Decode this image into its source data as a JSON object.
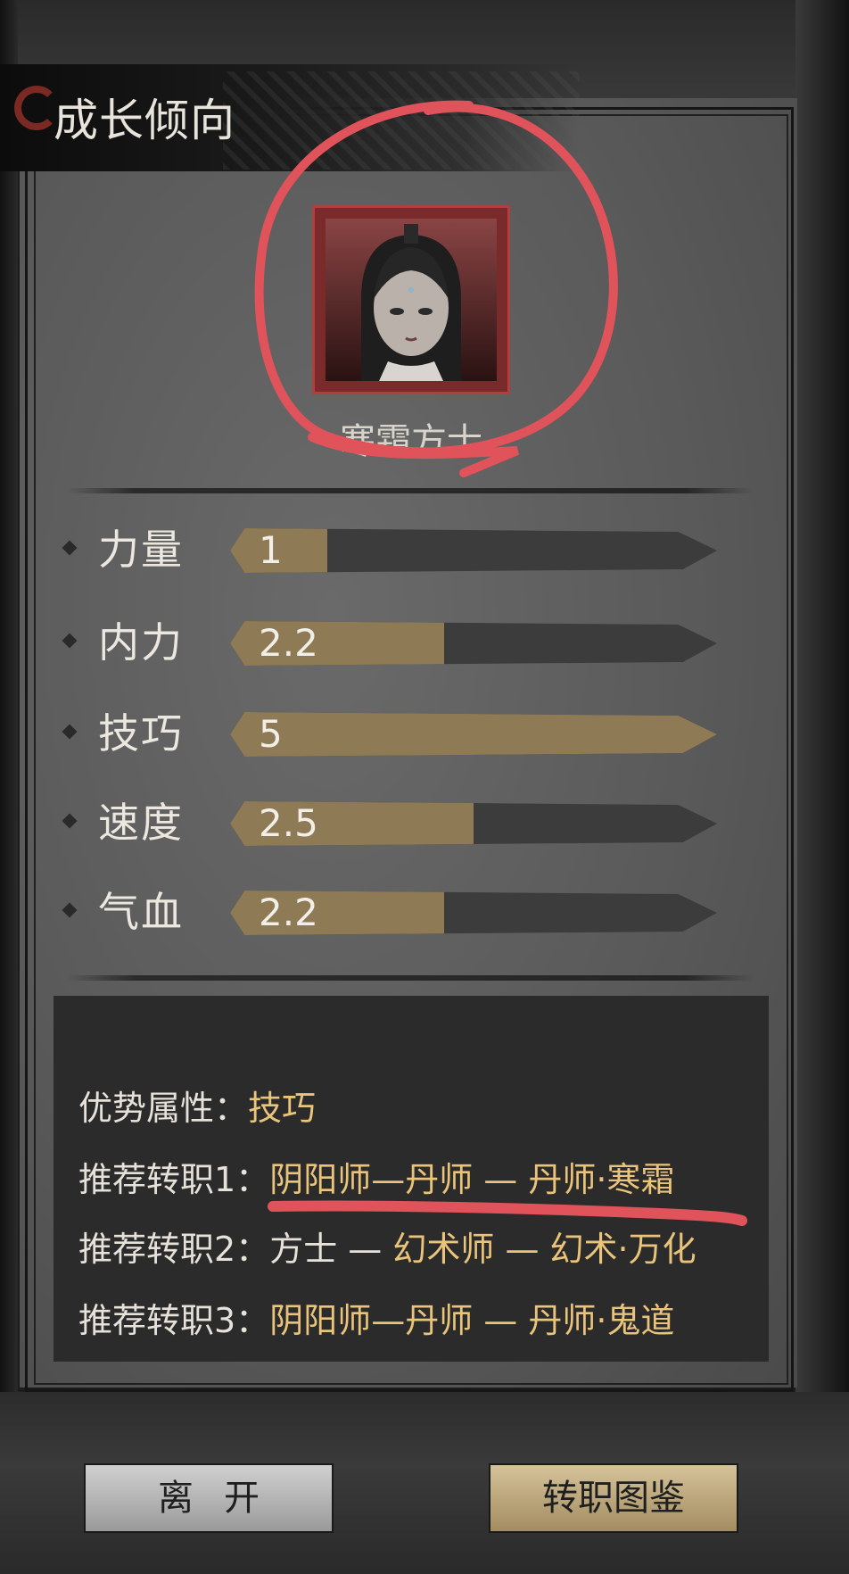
{
  "title": "成长倾向",
  "character": {
    "name": "寒霜方士"
  },
  "stats": [
    {
      "label": "力量",
      "value": "1",
      "fraction": 0.2
    },
    {
      "label": "内力",
      "value": "2.2",
      "fraction": 0.44
    },
    {
      "label": "技巧",
      "value": "5",
      "fraction": 1.0
    },
    {
      "label": "速度",
      "value": "2.5",
      "fraction": 0.5
    },
    {
      "label": "气血",
      "value": "2.2",
      "fraction": 0.44
    }
  ],
  "info": {
    "advantage_label": "优势属性：",
    "advantage_value": "技巧",
    "rec1_label": "推荐转职1：",
    "rec1_value": "阴阳师—丹师 — 丹师·寒霜",
    "rec2_label": "推荐转职2：",
    "rec2_plain": "方士 — ",
    "rec2_value": "幻术师 — 幻术·万化",
    "rec3_label": "推荐转职3：",
    "rec3_value": "阴阳师—丹师 — 丹师·鬼道"
  },
  "buttons": {
    "leave": "离开",
    "class_guide": "转职图鉴"
  },
  "colors": {
    "accent_gold": "#e9c47a",
    "bar_fill": "#8e7a55",
    "annotation_red": "#e0535a"
  }
}
